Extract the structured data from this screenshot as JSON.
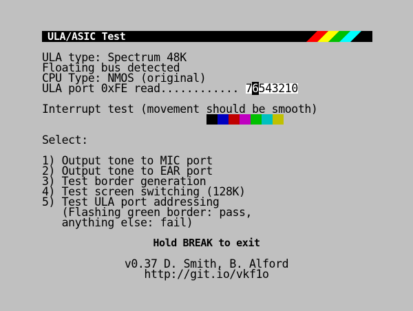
{
  "title": "ULA/ASIC Test",
  "info": {
    "ula_type": "ULA type: Spectrum 48K",
    "floating_bus": "Floating bus detected",
    "cpu_type": "CPU Type: NMOS (original)",
    "port_read_label": "ULA port 0xFE read............",
    "port_bit_7": "7",
    "port_bit_6": "6",
    "port_bits_rest": "543210"
  },
  "interrupt": {
    "label": "Interrupt test (movement should be smooth)",
    "swatch_colors": [
      "#000000",
      "#0000c0",
      "#c00000",
      "#c000c0",
      "#00c000",
      "#00c0c0",
      "#c0c000"
    ]
  },
  "select_label": "Select:",
  "menu": [
    "1) Output tone to MIC port",
    "2) Output tone to EAR port",
    "3) Test border generation",
    "4) Test screen switching (128K)",
    "5) Test ULA port addressing",
    "   (Flashing green border: pass,",
    "   anything else: fail)"
  ],
  "exit_hint": "Hold BREAK to exit",
  "credits": {
    "authors": "v0.37 D. Smith, B. Alford",
    "url": "http://git.io/vkf1o"
  },
  "colors": {
    "background": "#c0c0c0",
    "title_bar": "#000000",
    "stripe_red": "#ff0000",
    "stripe_yellow": "#ffff00",
    "stripe_green": "#00c000",
    "stripe_cyan": "#00ffff"
  }
}
